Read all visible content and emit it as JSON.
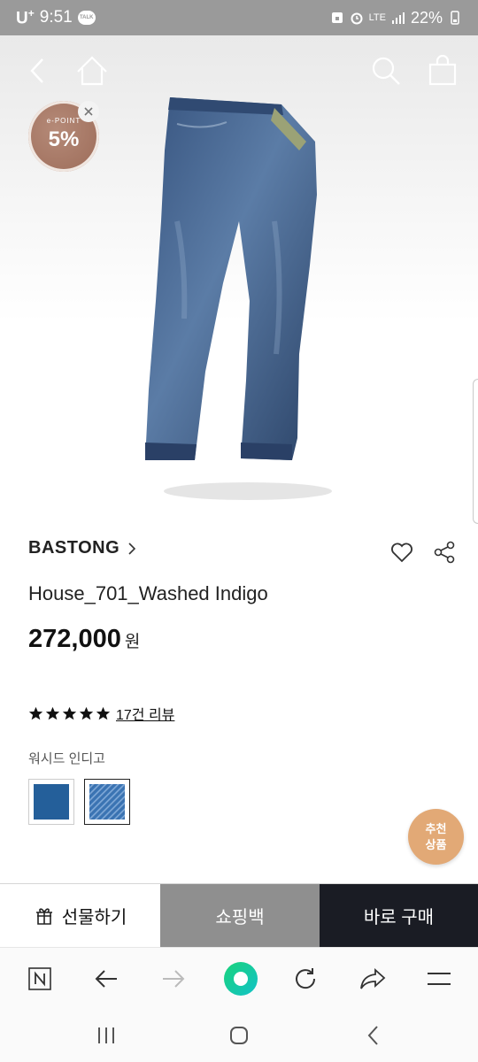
{
  "status_bar": {
    "carrier": "U",
    "carrier_sup": "+",
    "time": "9:51",
    "talk_badge": "TALK",
    "network": "LTE",
    "battery": "22%"
  },
  "hero": {
    "epoint": {
      "label": "e-POINT",
      "value": "5%"
    }
  },
  "product": {
    "brand": "BASTONG",
    "name": "House_701_Washed Indigo",
    "price": "272,000",
    "currency": "원",
    "rating": 5,
    "review_link": "17건 리뷰",
    "option_label": "워시드 인디고",
    "swatches": [
      {
        "name": "solid-indigo",
        "color": "#245f9a"
      },
      {
        "name": "denim-texture",
        "color": "#3a74b4"
      }
    ]
  },
  "recommend": {
    "line1": "추천",
    "line2": "상품"
  },
  "actions": {
    "gift": "선물하기",
    "cart": "쇼핑백",
    "buy": "바로 구매"
  },
  "browser": {
    "n_label": "N",
    "accent": "#19d37a"
  },
  "colors": {
    "buy_bg": "#1a1c24",
    "cart_bg": "#8f8f8f",
    "recommend_bg": "#e2a976",
    "epoint_bg": "#a7725e"
  }
}
